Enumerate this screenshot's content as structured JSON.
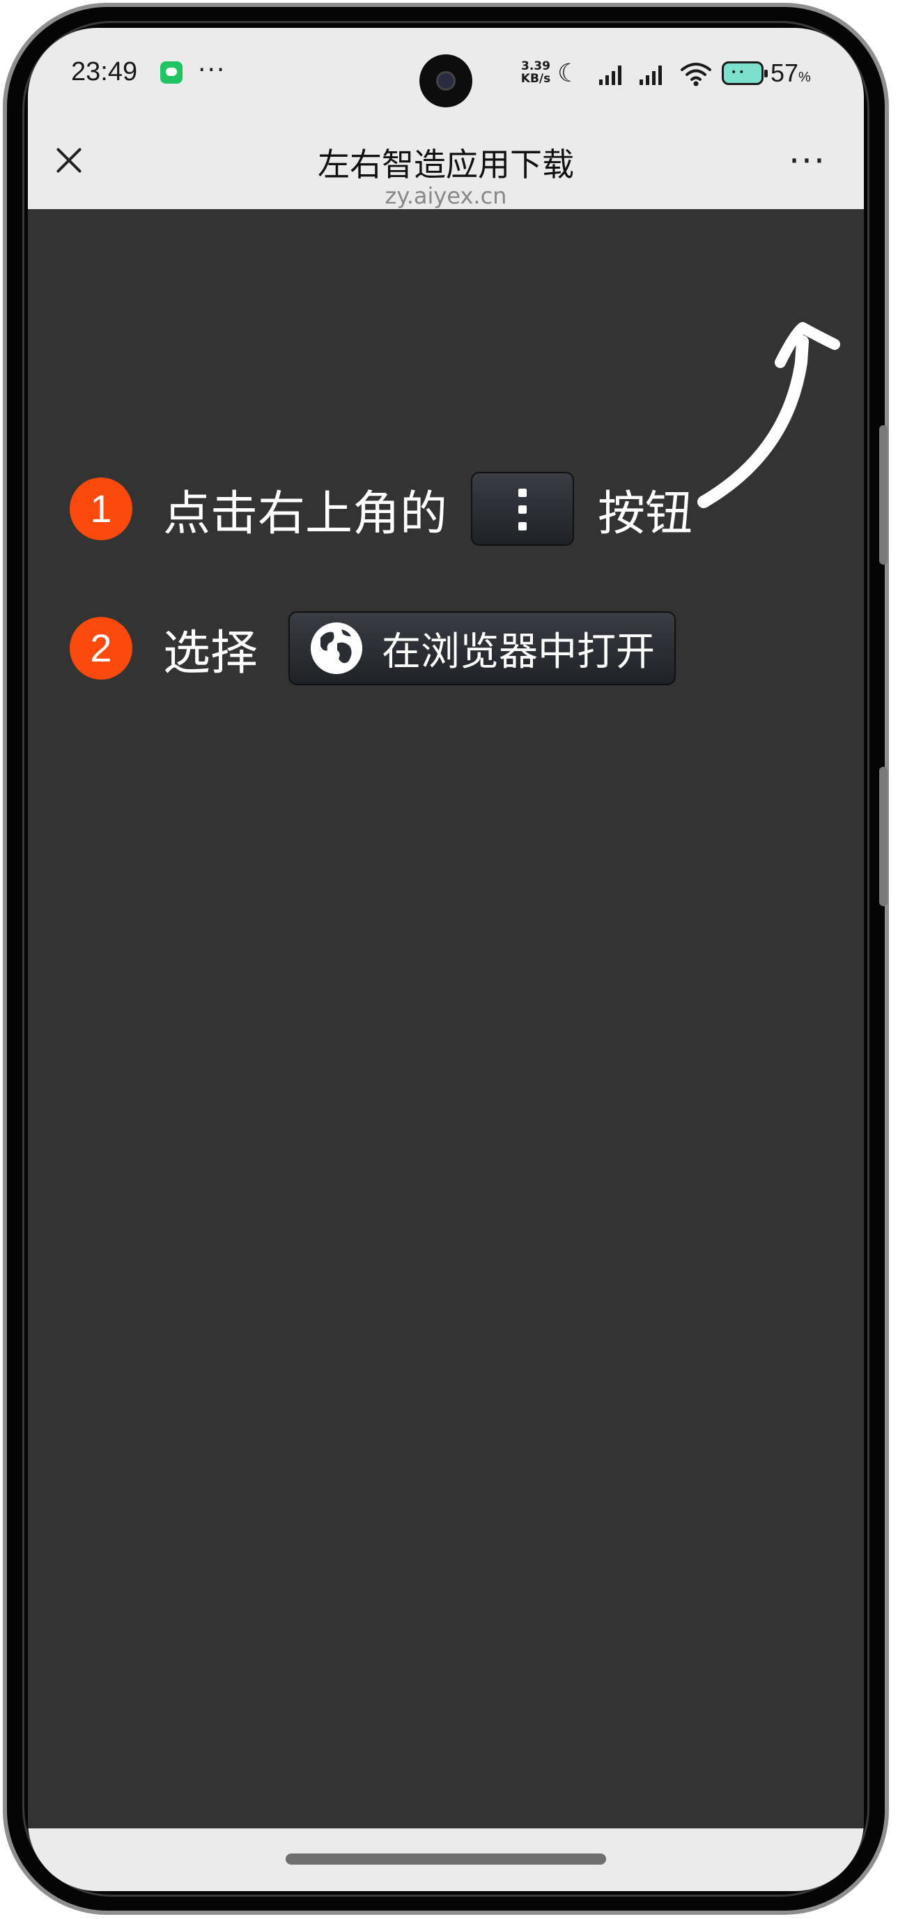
{
  "status_bar": {
    "time": "23:49",
    "overflow_dots": "···",
    "net_speed_value": "3.39",
    "net_speed_unit": "KB/s",
    "battery_percent": "57",
    "battery_unit": "%",
    "icons": [
      "wechat-icon",
      "moon-icon",
      "signal-icon",
      "signal-icon",
      "wifi-icon",
      "battery-icon"
    ]
  },
  "navbar": {
    "title": "左右智造应用下载",
    "url": "zy.aiyex.cn",
    "more_label": "···"
  },
  "steps": [
    {
      "number": "1",
      "text_before": "点击右上角的",
      "text_after": "按钮"
    },
    {
      "number": "2",
      "text_before": "选择",
      "button_label": "在浏览器中打开"
    }
  ],
  "colors": {
    "background": "#333333",
    "accent": "#fc4a0e",
    "header_bg": "#ebebeb"
  }
}
